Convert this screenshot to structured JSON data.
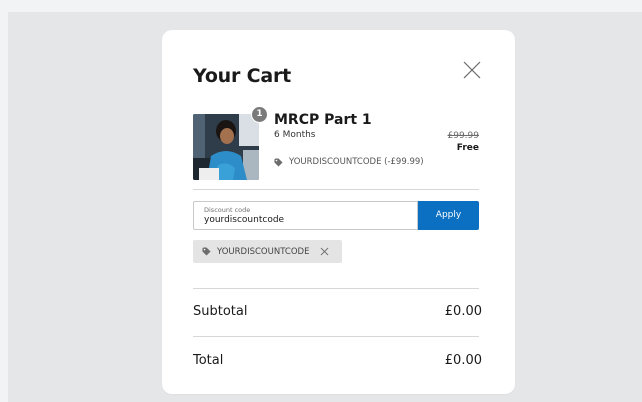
{
  "cart": {
    "title": "Your Cart",
    "close_icon": "close-icon"
  },
  "product": {
    "name": "MRCP Part 1",
    "variant": "6 Months",
    "quantity": "1",
    "original_price": "£99.99",
    "price": "Free",
    "discount_text": "YOURDISCOUNTCODE (-£99.99)",
    "tag_icon": "tag-icon"
  },
  "discount": {
    "label": "Discount code",
    "value": "yourdiscountcode",
    "apply_label": "Apply",
    "applied_code": "YOURDISCOUNTCODE"
  },
  "summary": {
    "subtotal_label": "Subtotal",
    "subtotal_value": "£0.00",
    "total_label": "Total",
    "total_value": "£0.00"
  },
  "colors": {
    "accent": "#0b6fc2",
    "chip_bg": "#e4e4e4",
    "backdrop": "#e5e6e8"
  }
}
